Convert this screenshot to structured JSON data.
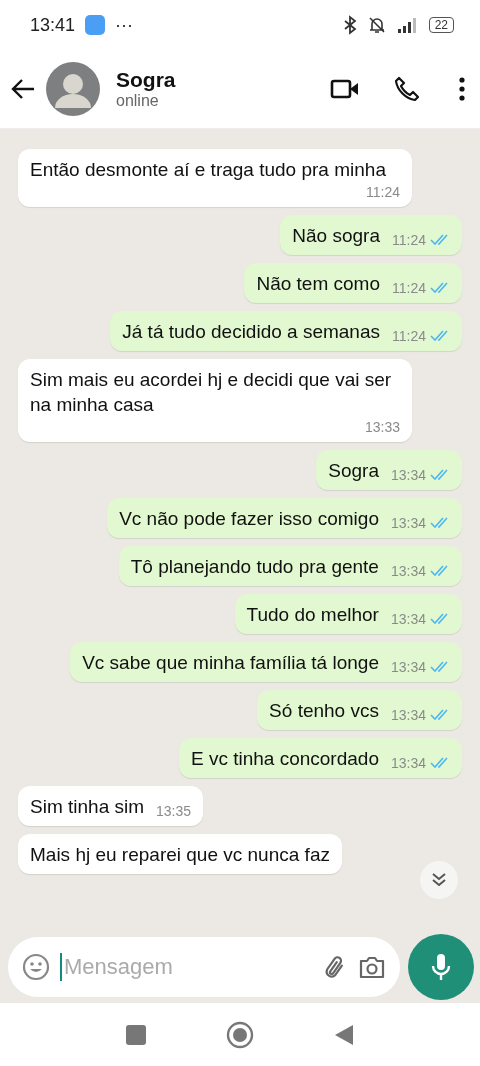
{
  "status_bar": {
    "time": "13:41",
    "more": "···",
    "battery": "22"
  },
  "header": {
    "name": "Sogra",
    "status": "online"
  },
  "messages": [
    {
      "kind": "received",
      "text": "Então desmonte aí e traga tudo pra minha",
      "time": "11:24"
    },
    {
      "kind": "sent",
      "text": "Não sogra",
      "time": "11:24",
      "read": true
    },
    {
      "kind": "sent",
      "text": "Não tem como",
      "time": "11:24",
      "read": true
    },
    {
      "kind": "sent",
      "text": "Já tá tudo decidido a semanas",
      "time": "11:24",
      "read": true
    },
    {
      "kind": "received",
      "text": "Sim mais eu acordei hj e decidi que vai ser na minha casa",
      "time": "13:33"
    },
    {
      "kind": "sent",
      "text": "Sogra",
      "time": "13:34",
      "read": true
    },
    {
      "kind": "sent",
      "text": "Vc não pode fazer isso comigo",
      "time": "13:34",
      "read": true
    },
    {
      "kind": "sent",
      "text": "Tô planejando tudo pra gente",
      "time": "13:34",
      "read": true
    },
    {
      "kind": "sent",
      "text": "Tudo do melhor",
      "time": "13:34",
      "read": true
    },
    {
      "kind": "sent",
      "text": "Vc sabe que minha família tá longe",
      "time": "13:34",
      "read": true
    },
    {
      "kind": "sent",
      "text": "Só tenho vcs",
      "time": "13:34",
      "read": true
    },
    {
      "kind": "sent",
      "text": "E vc tinha concordado",
      "time": "13:34",
      "read": true
    },
    {
      "kind": "received",
      "text": "Sim tinha sim",
      "time": "13:35"
    },
    {
      "kind": "received",
      "text": "Mais hj eu reparei que vc nunca faz"
    }
  ],
  "composer": {
    "placeholder": "Mensagem"
  }
}
